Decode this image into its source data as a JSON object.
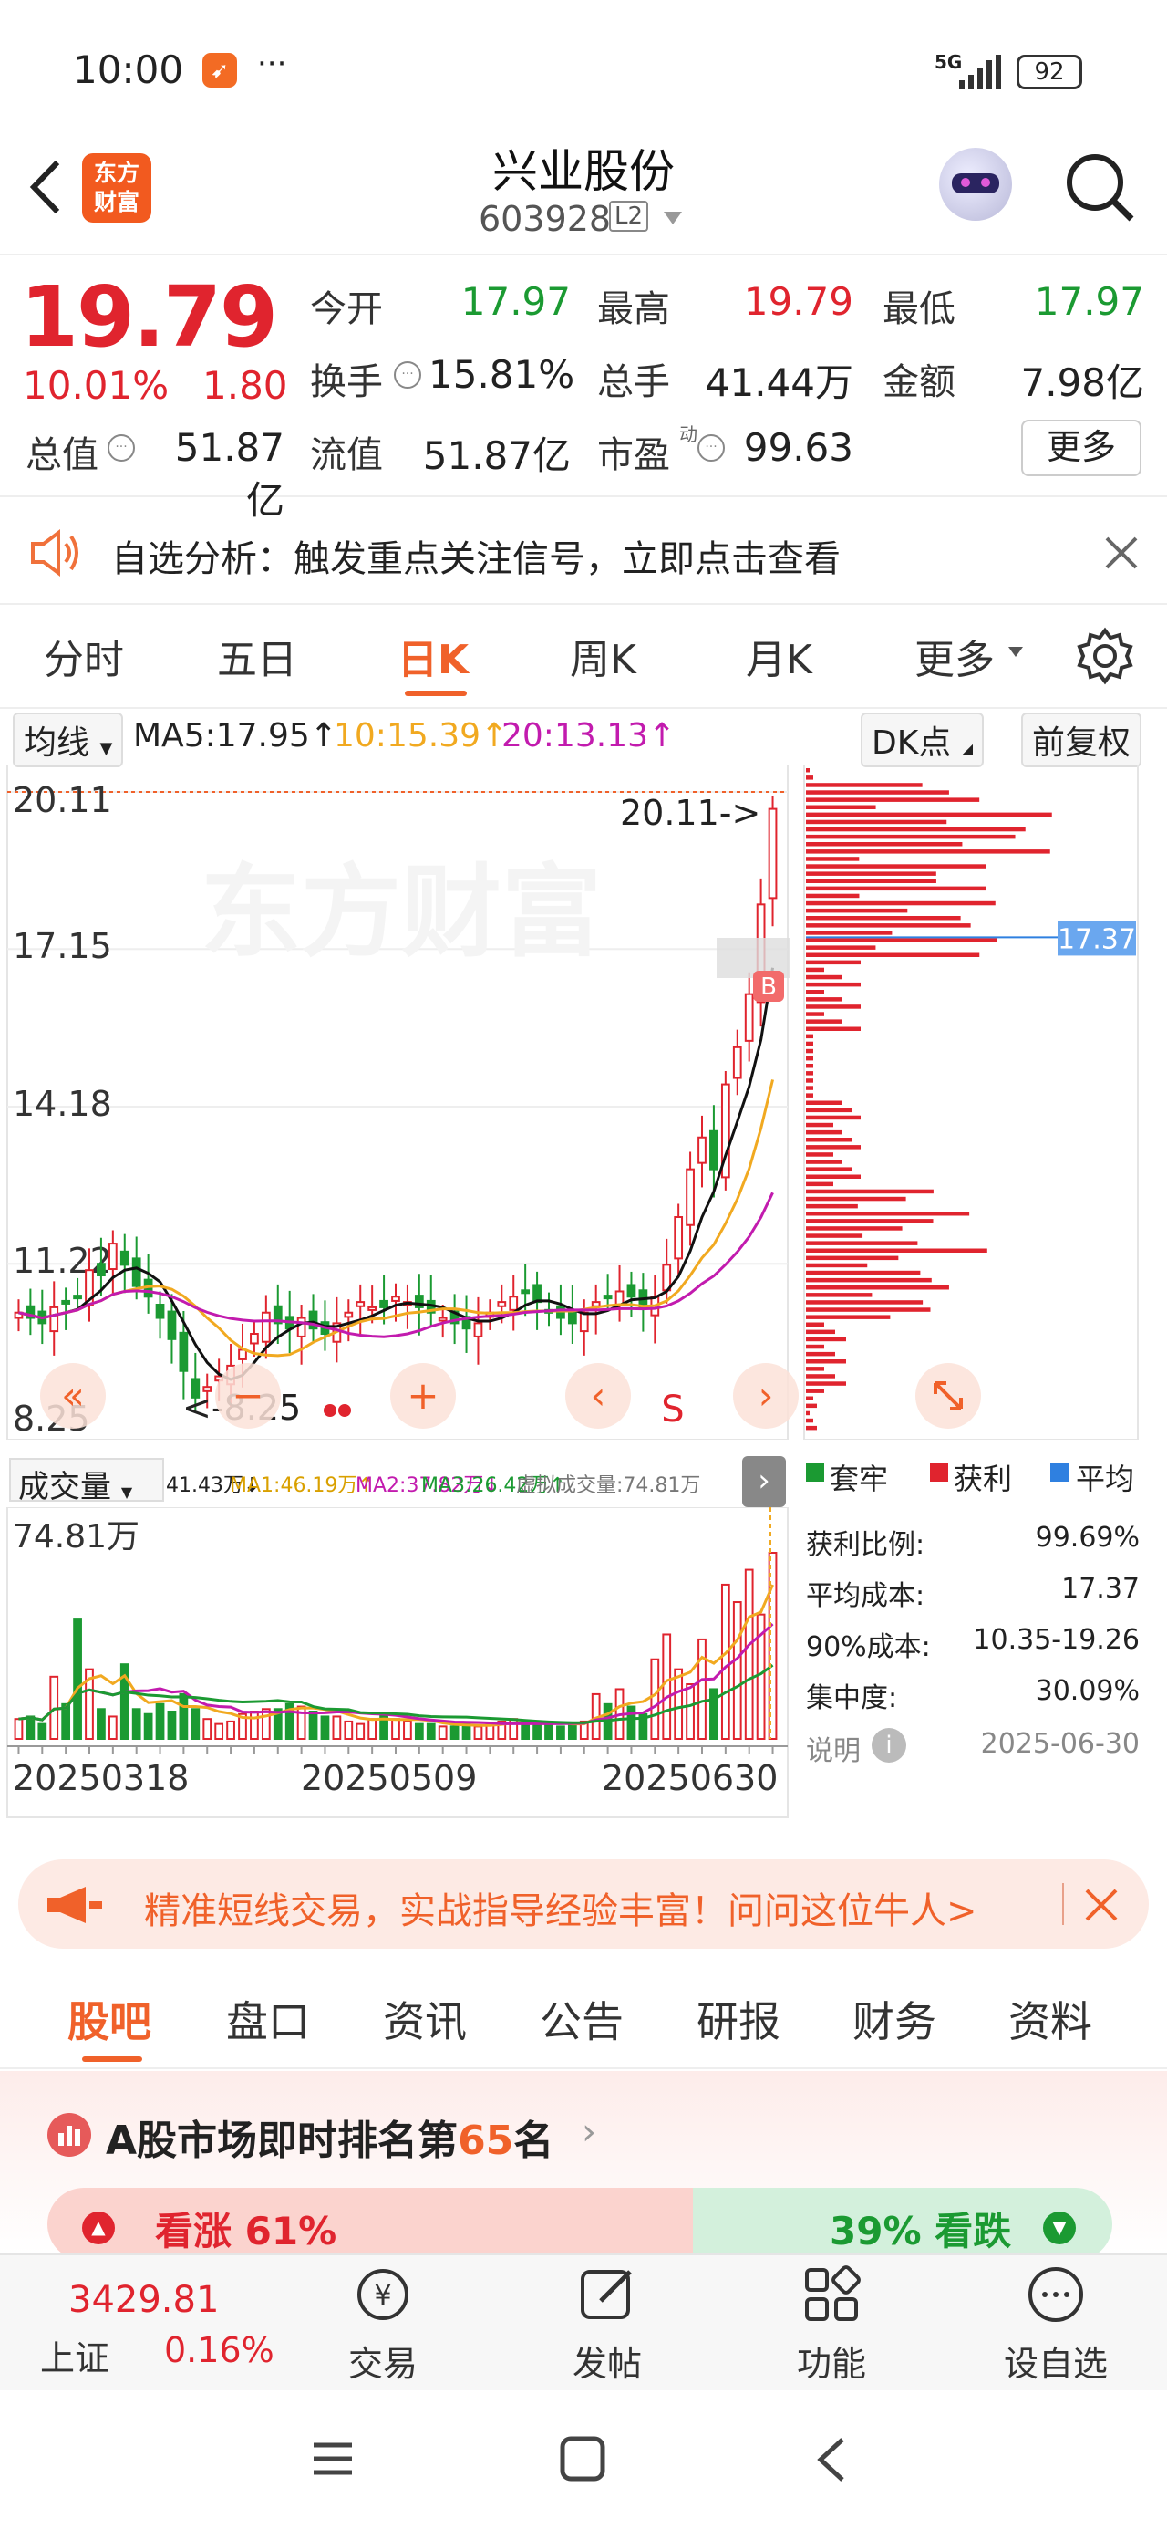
{
  "status": {
    "time": "10:00",
    "ellipsis": "···",
    "network": "5G",
    "battery": "92"
  },
  "nav": {
    "logo_line1": "东方",
    "logo_line2": "财富",
    "title": "兴业股份",
    "code": "603928",
    "level": "L2"
  },
  "quote": {
    "price": "19.79",
    "pct": "10.01%",
    "change": "1.80",
    "labels": {
      "open": "今开",
      "high": "最高",
      "low": "最低",
      "turnover": "换手",
      "total_hands": "总手",
      "amount": "金额",
      "total_cap": "总值",
      "float_cap": "流值",
      "pe": "市盈",
      "pe_sup": "动"
    },
    "values": {
      "open": "17.97",
      "high": "19.79",
      "low": "17.97",
      "turnover": "15.81%",
      "total_hands": "41.44万",
      "amount": "7.98亿",
      "total_cap": "51.87亿",
      "float_cap": "51.87亿",
      "pe": "99.63"
    },
    "more": "更多"
  },
  "notice": {
    "text": "自选分析：触发重点关注信号，立即点击查看"
  },
  "ktabs": [
    "分时",
    "五日",
    "日K",
    "周K",
    "月K",
    "更多"
  ],
  "chart": {
    "ma_selector": "均线",
    "ma5": "MA5:17.95↑",
    "ma10": "10:15.39↑",
    "ma20": "20:13.13↑",
    "dk_button": "DK点",
    "adj_button": "前复权",
    "y_labels": [
      "20.11",
      "17.15",
      "14.18",
      "11.22",
      "8.25"
    ],
    "max_note": "20.11->",
    "min_note": "<-8.25",
    "watermark": "东方财富",
    "b_marker": "B",
    "s_marker": "S",
    "chip_avg": "17.37",
    "vol_selector": "成交量",
    "vol_vol": "41.43万↓",
    "vol_ma1": "MA1:46.19万↑",
    "vol_ma2": "MA2:37.82万↓",
    "vol_ma3": "MA3:26.42万↑",
    "vol_virtual": "虚拟成交量:74.81万",
    "vol_max": "74.81万",
    "dates": [
      "20250318",
      "20250509",
      "20250630"
    ],
    "legend": [
      "套牢",
      "获利",
      "平均"
    ],
    "chip_stats": [
      [
        "获利比例:",
        "99.69%"
      ],
      [
        "平均成本:",
        "17.37"
      ],
      [
        "90%成本:",
        "10.35-19.26"
      ],
      [
        "集中度:",
        "30.09%"
      ]
    ],
    "explain": "说明",
    "chip_date": "2025-06-30"
  },
  "chart_data": {
    "type": "candlestick",
    "last_close": 19.79,
    "ma5": 17.95,
    "ma10": 15.39,
    "ma20": 13.13,
    "y_range": [
      8.25,
      20.11
    ],
    "high": 20.11,
    "low": 8.25,
    "closes": [
      10.3,
      10.2,
      10.1,
      10.4,
      10.5,
      10.6,
      11.1,
      11.0,
      11.6,
      11.2,
      10.8,
      10.6,
      10.2,
      9.8,
      9.2,
      8.7,
      8.9,
      9.1,
      9.3,
      9.6,
      9.9,
      10.3,
      10.1,
      10.0,
      10.2,
      10.0,
      9.9,
      10.1,
      10.3,
      10.5,
      10.4,
      10.4,
      10.6,
      10.5,
      10.4,
      10.3,
      10.2,
      10.1,
      10.0,
      10.1,
      10.3,
      10.5,
      10.6,
      10.7,
      10.5,
      10.3,
      10.2,
      10.1,
      10.3,
      10.5,
      10.6,
      10.7,
      10.6,
      10.4,
      10.6,
      11.2,
      12.1,
      13.0,
      13.6,
      13.0,
      14.6,
      15.3,
      16.3,
      17.99,
      19.79
    ],
    "volumes": [
      8,
      9,
      6,
      25,
      14,
      48,
      28,
      12,
      9,
      30,
      12,
      10,
      14,
      11,
      18,
      12,
      8,
      6,
      7,
      10,
      11,
      12,
      12,
      14,
      13,
      11,
      9,
      9,
      7,
      6,
      8,
      10,
      8,
      7,
      6,
      6,
      5,
      5,
      6,
      5,
      6,
      7,
      8,
      7,
      6,
      6,
      5,
      6,
      7,
      18,
      14,
      20,
      13,
      10,
      32,
      42,
      28,
      22,
      40,
      20,
      62,
      55,
      68,
      50,
      74.81
    ]
  },
  "banner": {
    "text": "精准短线交易，实战指导经验丰富！问问这位牛人>"
  },
  "info_tabs": [
    "股吧",
    "盘口",
    "资讯",
    "公告",
    "研报",
    "财务",
    "资料"
  ],
  "rank": {
    "prefix": "A股市场即时排名第",
    "number": "65",
    "suffix": "名",
    "up": "看涨 61%",
    "down": "39% 看跌"
  },
  "bottom": {
    "index_value": "3429.81",
    "index_name": "上证",
    "index_pct": "0.16%",
    "trade": "交易",
    "post": "发帖",
    "func": "功能",
    "watch": "设自选"
  }
}
